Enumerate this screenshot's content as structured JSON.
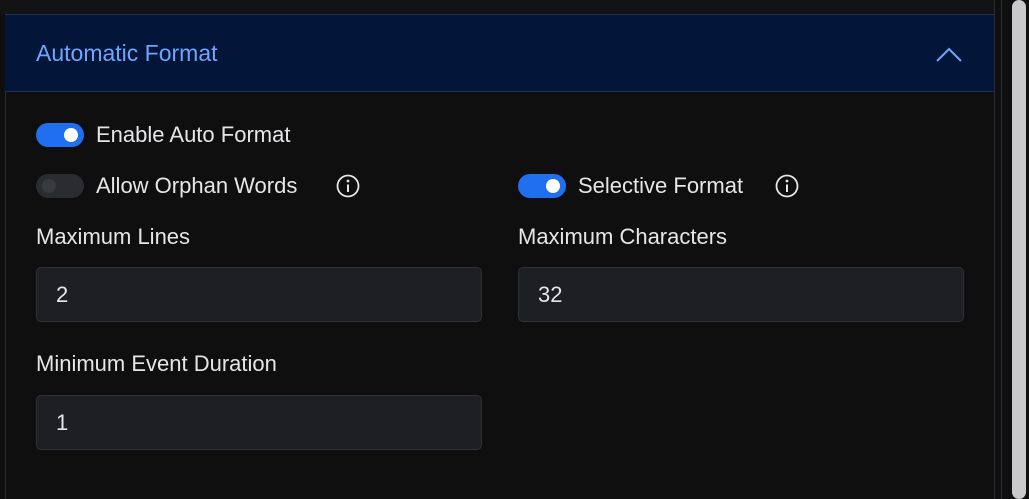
{
  "section": {
    "title": "Automatic Format",
    "collapse_icon": "chevron-up-icon"
  },
  "toggles": {
    "enable_auto_format": {
      "label": "Enable Auto Format",
      "on": true
    },
    "allow_orphan_words": {
      "label": "Allow Orphan Words",
      "on": false,
      "info_icon": "info-icon"
    },
    "selective_format": {
      "label": "Selective Format",
      "on": true,
      "info_icon": "info-icon"
    }
  },
  "fields": {
    "maximum_lines": {
      "label": "Maximum Lines",
      "value": "2"
    },
    "maximum_characters": {
      "label": "Maximum Characters",
      "value": "32"
    },
    "minimum_event_duration": {
      "label": "Minimum Event Duration",
      "value": "1"
    }
  },
  "colors": {
    "accent": "#1f6ff0",
    "header_bg": "#03163a",
    "header_text": "#6ea6ff",
    "page_bg": "#0f0f10",
    "input_bg": "#1e1f23"
  }
}
